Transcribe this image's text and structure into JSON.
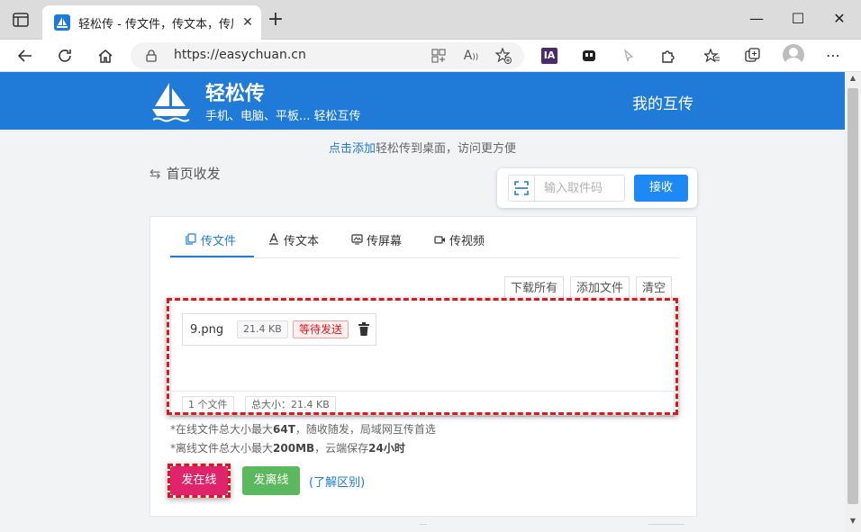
{
  "browser": {
    "tab_title": "轻松传 - 传文件，传文本，传屏幕",
    "tab_close": "✕",
    "new_tab": "+",
    "url": "https://easychuan.cn",
    "extension_ia": "IA",
    "window_controls": {
      "minimize": "—",
      "maximize": "☐",
      "close": "✕"
    }
  },
  "site": {
    "brand_name": "轻松传",
    "brand_tagline": "手机、电脑、平板... 轻松互传",
    "nav_my_transfers": "我的互传",
    "notice_link": "点击添加",
    "notice_text": "轻松传到桌面，访问更方便",
    "section_icon": "⇆",
    "section_title": "首页收发"
  },
  "receive": {
    "placeholder": "输入取件码",
    "button": "接收"
  },
  "tabs": [
    {
      "label": "传文件",
      "icon": "copy-icon",
      "active": true
    },
    {
      "label": "传文本",
      "icon": "text-icon",
      "active": false
    },
    {
      "label": "传屏幕",
      "icon": "screen-icon",
      "active": false
    },
    {
      "label": "传视频",
      "icon": "video-icon",
      "active": false
    }
  ],
  "file_actions": {
    "download_all": "下载所有",
    "add_file": "添加文件",
    "clear": "清空"
  },
  "files": [
    {
      "name": "9.png",
      "size": "21.4 KB",
      "status": "等待发送"
    }
  ],
  "summary": {
    "count": "1 个文件",
    "total": "总大小：21.4 KB"
  },
  "notes": {
    "online_prefix": "*在线文件总大小最大",
    "online_limit": "64T",
    "online_suffix": "，随收随发，局域网互传首选",
    "offline_prefix": "*离线文件总大小最大",
    "offline_limit": "200MB",
    "offline_mid": "，云端保存",
    "offline_duration": "24小时"
  },
  "actions": {
    "send_online": "发在线",
    "send_offline": "发离线",
    "learn_difference": "(了解区别)"
  },
  "colors": {
    "brand_blue": "#1f7ad8",
    "online_button": "#e0246c",
    "offline_button": "#5cb85c",
    "highlight_red": "#e0161c"
  }
}
